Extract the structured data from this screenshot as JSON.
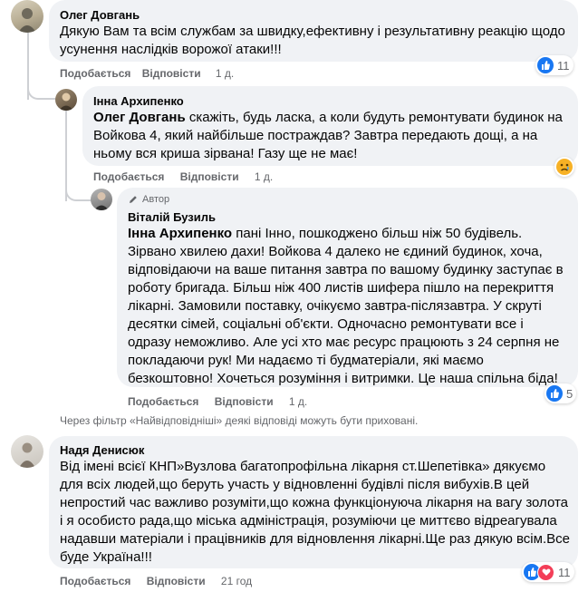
{
  "comments": [
    {
      "author": "Олег Довгань",
      "text": "Дякую Вам та всім службам за швидку,ефективну і результативну реакцію щодо усунення наслідків ворожої атаки!!!",
      "like_label": "Подобається",
      "reply_label": "Відповісти",
      "time": "1 д.",
      "reaction_count": "11",
      "reactions": [
        "like-icon"
      ]
    },
    {
      "author": "Інна Архипенко",
      "mention": "Олег Довгань",
      "text": " скажіть, будь ласка, а коли будуть ремонтувати будинок на Войкова 4, який найбільше постраждав? Завтра передають дощі, а на ньому вся криша зірвана! Газу ще не має!",
      "like_label": "Подобається",
      "reply_label": "Відповісти",
      "time": "1 д.",
      "reactions": [
        "sad-icon"
      ]
    },
    {
      "badge": "Автор",
      "author": "Віталій Бузиль",
      "mention": "Інна Архипенко",
      "text": " пані Інно, пошкоджено більш ніж 50 будівель. Зірвано хвилею дахи! Войкова 4 далеко не єдиний будинок, хоча, відповідаючи на ваше питання завтра по вашому будинку заступає в роботу бригада. Більш ніж 400 листів шифера пішло на перекриття лікарні. Замовили поставку, очікуємо завтра-післязавтра. У скруті десятки сімей, соціальні об'єкти. Одночасно ремонтувати все і одразу неможливо. Але усі хто має ресурс працюють з 24 серпня не покладаючи рук! Ми надаємо ті будматеріали, які маємо безкоштовно! Хочеться розуміння і витримки. Це наша спільна біда!",
      "like_label": "Подобається",
      "reply_label": "Відповісти",
      "time": "1 д.",
      "reaction_count": "5",
      "reactions": [
        "like-icon"
      ]
    },
    {
      "author": "Надя Денисюк",
      "text": "Від імені всієї КНП»Вузлова багатопрофільна лікарня ст.Шепетівка» дякуємо для всіх людей,що беруть участь у відновленні будівлі після вибухів.В цей непростий час важливо розуміти,що кожна функціонуюча лікарня на вагу золота і я особисто рада,що міська адміністрація, розуміючи це миттєво відреагувала надавши матеріали і працівників для відновлення лікарні.Ще раз дякую всім.Все буде Україна!!!",
      "like_label": "Подобається",
      "reply_label": "Відповісти",
      "time": "21 год",
      "reaction_count": "11",
      "reactions": [
        "like-icon",
        "love-icon"
      ]
    }
  ],
  "filter_note": "Через фільтр «Найвідповідніші» деякі відповіді можуть бути приховані.",
  "colors": {
    "bubble": "#f0f2f5",
    "meta": "#65676b",
    "like": "#1877f2",
    "love": "#f33e58",
    "sad": "#f7b125"
  }
}
